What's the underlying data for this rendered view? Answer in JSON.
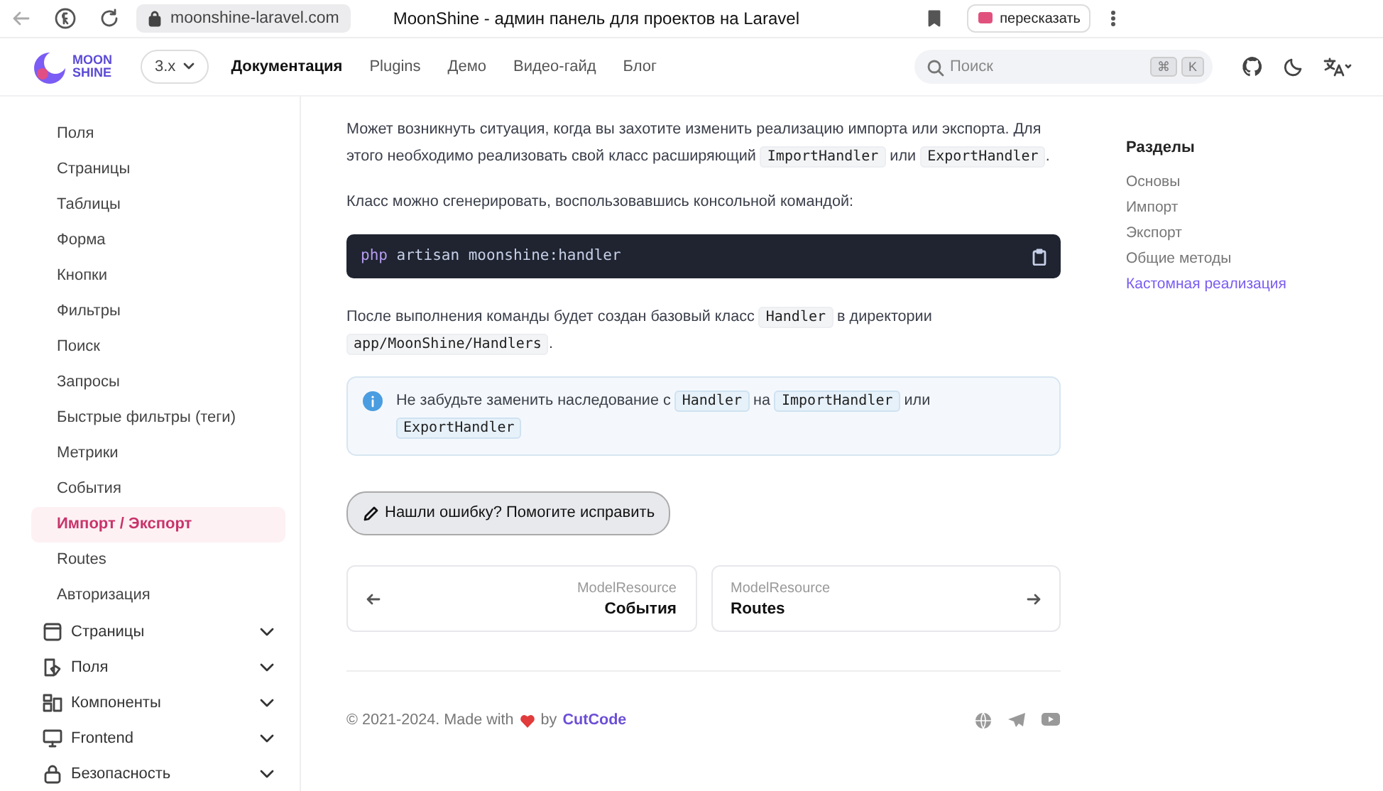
{
  "browser": {
    "url": "moonshine-laravel.com",
    "title": "MoonShine - админ панель для проектов на Laravel",
    "summarize_button": "пересказать"
  },
  "header": {
    "logo_top": "MOON",
    "logo_bottom": "SHINE",
    "version": "3.x",
    "nav": [
      {
        "label": "Документация",
        "selected": true
      },
      {
        "label": "Plugins",
        "selected": false
      },
      {
        "label": "Демо",
        "selected": false
      },
      {
        "label": "Видео-гайд",
        "selected": false
      },
      {
        "label": "Блог",
        "selected": false
      }
    ],
    "search": {
      "placeholder": "Поиск",
      "keys": [
        "⌘",
        "K"
      ]
    }
  },
  "sidebar": {
    "items": [
      {
        "label": "Поля",
        "selected": false
      },
      {
        "label": "Страницы",
        "selected": false
      },
      {
        "label": "Таблицы",
        "selected": false
      },
      {
        "label": "Форма",
        "selected": false
      },
      {
        "label": "Кнопки",
        "selected": false
      },
      {
        "label": "Фильтры",
        "selected": false
      },
      {
        "label": "Поиск",
        "selected": false
      },
      {
        "label": "Запросы",
        "selected": false
      },
      {
        "label": "Быстрые фильтры (теги)",
        "selected": false
      },
      {
        "label": "Метрики",
        "selected": false
      },
      {
        "label": "События",
        "selected": false
      },
      {
        "label": "Импорт / Экспорт",
        "selected": true
      },
      {
        "label": "Routes",
        "selected": false
      },
      {
        "label": "Авторизация",
        "selected": false
      }
    ],
    "groups": [
      {
        "label": "Страницы",
        "expanded": false
      },
      {
        "label": "Поля",
        "expanded": false
      },
      {
        "label": "Компоненты",
        "expanded": false
      },
      {
        "label": "Frontend",
        "expanded": false
      },
      {
        "label": "Безопасность",
        "expanded": false
      }
    ]
  },
  "content": {
    "paragraphs": [
      [
        {
          "kind": "text",
          "text": "Может возникнуть ситуация, когда вы захотите изменить реализацию импорта или экспорта. Для этого необходимо реализовать свой класс расширяющий "
        },
        {
          "kind": "code",
          "text": "ImportHandler"
        },
        {
          "kind": "text",
          "text": " или "
        },
        {
          "kind": "code",
          "text": "ExportHandler"
        },
        {
          "kind": "text",
          "text": "."
        }
      ],
      [
        {
          "kind": "text",
          "text": "Класс можно сгенерировать, воспользовавшись консольной командой:"
        }
      ]
    ],
    "code_block": [
      {
        "kind": "keyword",
        "text": "php"
      },
      {
        "kind": "plain",
        "text": " artisan moonshine:handler"
      }
    ],
    "after_code": [
      {
        "kind": "text",
        "text": "После выполнения команды будет создан базовый класс "
      },
      {
        "kind": "code",
        "text": "Handler"
      },
      {
        "kind": "text",
        "text": " в директории "
      },
      {
        "kind": "code",
        "text": "app/MoonShine/Handlers"
      },
      {
        "kind": "text",
        "text": "."
      }
    ],
    "note": [
      {
        "kind": "text",
        "text": "Не забудьте заменить наследование с "
      },
      {
        "kind": "code",
        "text": "Handler"
      },
      {
        "kind": "text",
        "text": " на "
      },
      {
        "kind": "code",
        "text": "ImportHandler"
      },
      {
        "kind": "text",
        "text": " или "
      },
      {
        "kind": "code",
        "text": "ExportHandler"
      }
    ],
    "edit_button": "Нашли ошибку? Помогите исправить",
    "pager": {
      "prev": {
        "label": "ModelResource",
        "title": "События"
      },
      "next": {
        "label": "ModelResource",
        "title": "Routes"
      }
    },
    "footer": {
      "copyright": "© 2021-2024. Made with",
      "by": "by",
      "link": "CutCode"
    }
  },
  "toc": {
    "title": "Разделы",
    "items": [
      {
        "label": "Основы",
        "selected": false
      },
      {
        "label": "Импорт",
        "selected": false
      },
      {
        "label": "Экспорт",
        "selected": false
      },
      {
        "label": "Общие методы",
        "selected": false
      },
      {
        "label": "Кастомная реализация",
        "selected": true
      }
    ]
  }
}
